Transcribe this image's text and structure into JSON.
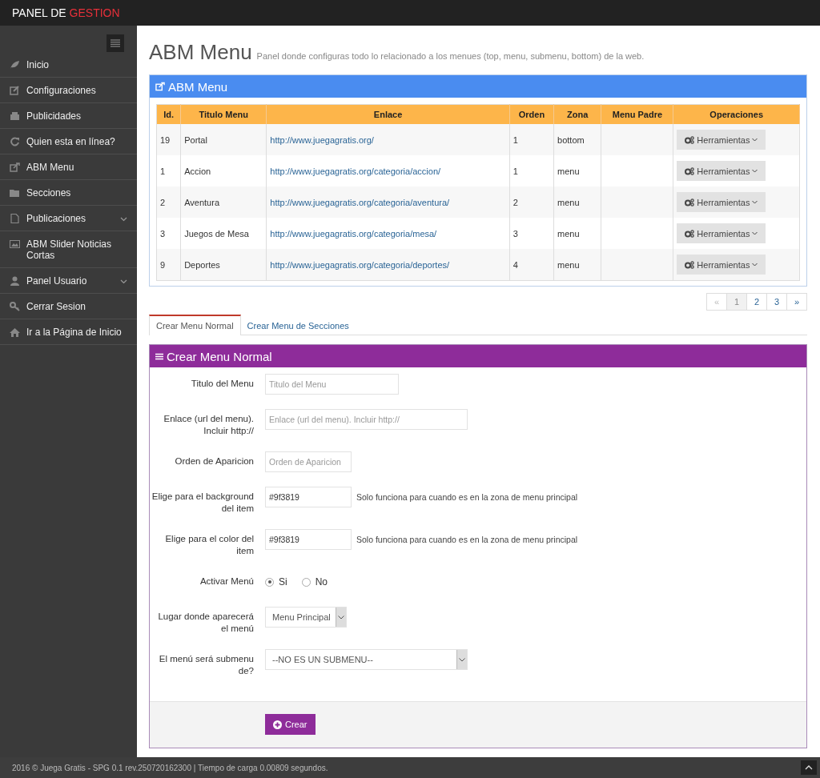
{
  "brand": {
    "text": "PANEL DE",
    "accent": "GESTION"
  },
  "sidebar": {
    "items": [
      {
        "label": "Inicio",
        "has_submenu": false
      },
      {
        "label": "Configuraciones",
        "has_submenu": false
      },
      {
        "label": "Publicidades",
        "has_submenu": false
      },
      {
        "label": "Quien esta en línea?",
        "has_submenu": false
      },
      {
        "label": "ABM Menu",
        "has_submenu": false
      },
      {
        "label": "Secciones",
        "has_submenu": false
      },
      {
        "label": "Publicaciones",
        "has_submenu": true
      },
      {
        "label": "ABM Slider Noticias Cortas",
        "has_submenu": false
      },
      {
        "label": "Panel Usuario",
        "has_submenu": true
      },
      {
        "label": "Cerrar Sesion",
        "has_submenu": false
      },
      {
        "label": "Ir a la Página de Inicio",
        "has_submenu": false
      }
    ]
  },
  "page": {
    "title": "ABM Menu",
    "subtitle": "Panel donde configuras todo lo relacionado a los menues (top, menu, submenu, bottom) de la web."
  },
  "table_panel": {
    "title": "ABM Menu",
    "columns": [
      "Id.",
      "Titulo Menu",
      "Enlace",
      "Orden",
      "Zona",
      "Menu Padre",
      "Operaciones"
    ],
    "rows": [
      {
        "id": "19",
        "title": "Portal",
        "link": "http://www.juegagratis.org/",
        "order": "1",
        "zone": "bottom",
        "action": "Herramientas"
      },
      {
        "id": "1",
        "title": "Accion",
        "link": "http://www.juegagratis.org/categoria/accion/",
        "order": "1",
        "zone": "menu",
        "action": "Herramientas"
      },
      {
        "id": "2",
        "title": "Aventura",
        "link": "http://www.juegagratis.org/categoria/aventura/",
        "order": "2",
        "zone": "menu",
        "action": "Herramientas"
      },
      {
        "id": "3",
        "title": "Juegos de Mesa",
        "link": "http://www.juegagratis.org/categoria/mesa/",
        "order": "3",
        "zone": "menu",
        "action": "Herramientas"
      },
      {
        "id": "9",
        "title": "Deportes",
        "link": "http://www.juegagratis.org/categoria/deportes/",
        "order": "4",
        "zone": "menu",
        "action": "Herramientas"
      }
    ],
    "pagination": [
      {
        "label": "«",
        "selected": false,
        "disabled": true
      },
      {
        "label": "1",
        "selected": true,
        "disabled": false
      },
      {
        "label": "2",
        "selected": false,
        "disabled": false
      },
      {
        "label": "3",
        "selected": false,
        "disabled": false
      },
      {
        "label": "»",
        "selected": false,
        "disabled": false
      }
    ]
  },
  "tabs": [
    {
      "label": "Crear Menu Normal",
      "selected": true
    },
    {
      "label": "Crear Menu de Secciones",
      "selected": false
    }
  ],
  "form_panel": {
    "title": "Crear Menu Normal",
    "fields": [
      {
        "kind": "text",
        "label": "Titulo del Menu",
        "placeholder": "Titulo del Menu"
      },
      {
        "kind": "text",
        "label": "Enlace (url del menu). Incluir http://",
        "placeholder": "Enlace (url del menu). Incluir http://"
      },
      {
        "kind": "text",
        "label": "Orden de Aparicion",
        "placeholder": "Orden de Aparicion"
      },
      {
        "kind": "text",
        "label": "Elige para el background del item",
        "value": "#9f3819",
        "help": "Solo funciona para cuando es en la zona de menu principal"
      },
      {
        "kind": "text",
        "label": "Elige para el color del item",
        "value": "#9f3819",
        "help": "Solo funciona para cuando es en la zona de menu principal"
      },
      {
        "kind": "radio",
        "label": "Activar Menú",
        "options": [
          {
            "label": "Si",
            "selected": true
          },
          {
            "label": "No",
            "selected": false
          }
        ]
      },
      {
        "kind": "select",
        "label": "Lugar donde aparecerá el menú",
        "value": "Menu Principal"
      },
      {
        "kind": "select",
        "label": "El menú será submenu de?",
        "value": "--NO ES UN SUBMENU--"
      }
    ],
    "submit": "Crear"
  },
  "footer": {
    "text": "2016 © Juega Gratis - SPG 0.1 rev.250720162300 | Tiempo de carga 0.00809 segundos."
  }
}
